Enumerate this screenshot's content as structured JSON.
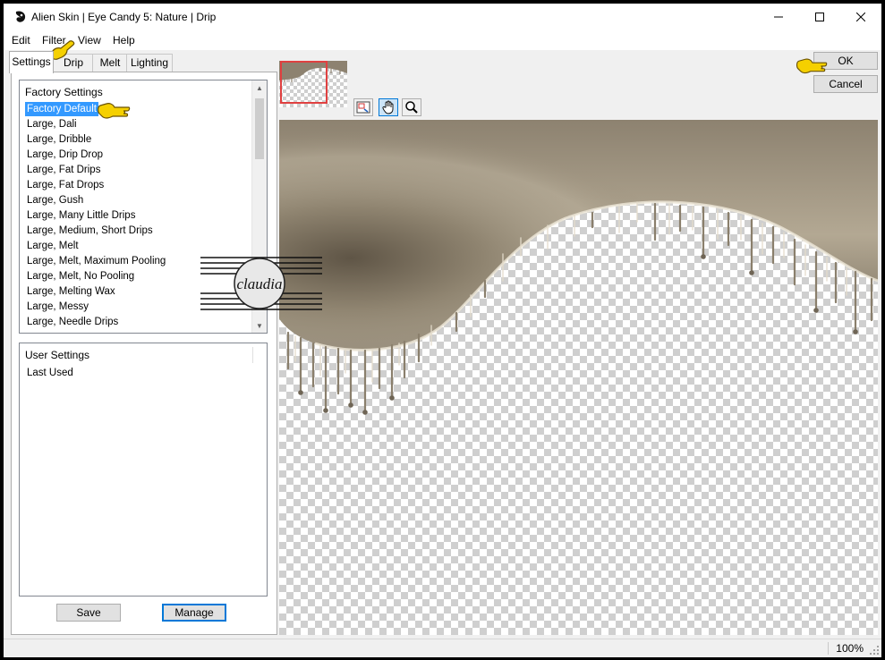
{
  "window": {
    "title": "Alien Skin | Eye Candy 5: Nature | Drip"
  },
  "menu": [
    "Edit",
    "Filter",
    "View",
    "Help"
  ],
  "tabs": [
    "Settings",
    "Drip",
    "Melt",
    "Lighting"
  ],
  "factory_settings": {
    "header": "Factory Settings",
    "items": [
      "Factory Default",
      "Large, Dali",
      "Large, Dribble",
      "Large, Drip Drop",
      "Large, Fat Drips",
      "Large, Fat Drops",
      "Large, Gush",
      "Large, Many Little Drips",
      "Large, Medium, Short Drips",
      "Large, Melt",
      "Large, Melt, Maximum Pooling",
      "Large, Melt, No Pooling",
      "Large, Melting Wax",
      "Large, Messy",
      "Large, Needle Drips"
    ],
    "selected": "Factory Default"
  },
  "user_settings": {
    "header": "User Settings",
    "items": [
      "Last Used"
    ]
  },
  "buttons": {
    "save": "Save",
    "manage": "Manage",
    "ok": "OK",
    "cancel": "Cancel"
  },
  "status": {
    "zoom": "100%"
  },
  "watermark": {
    "text": "claudia"
  },
  "colors": {
    "drip_base": "#8d8270",
    "drip_light": "#c8bfae",
    "selection": "#3399ff",
    "pointer": "#f5d000"
  },
  "icons": [
    "app-icon",
    "minimize-icon",
    "maximize-icon",
    "close-icon",
    "scroll-up-icon",
    "scroll-down-icon",
    "navigator-icon",
    "hand-tool-icon",
    "zoom-tool-icon",
    "pointing-hand-icon",
    "resize-grip-icon"
  ]
}
